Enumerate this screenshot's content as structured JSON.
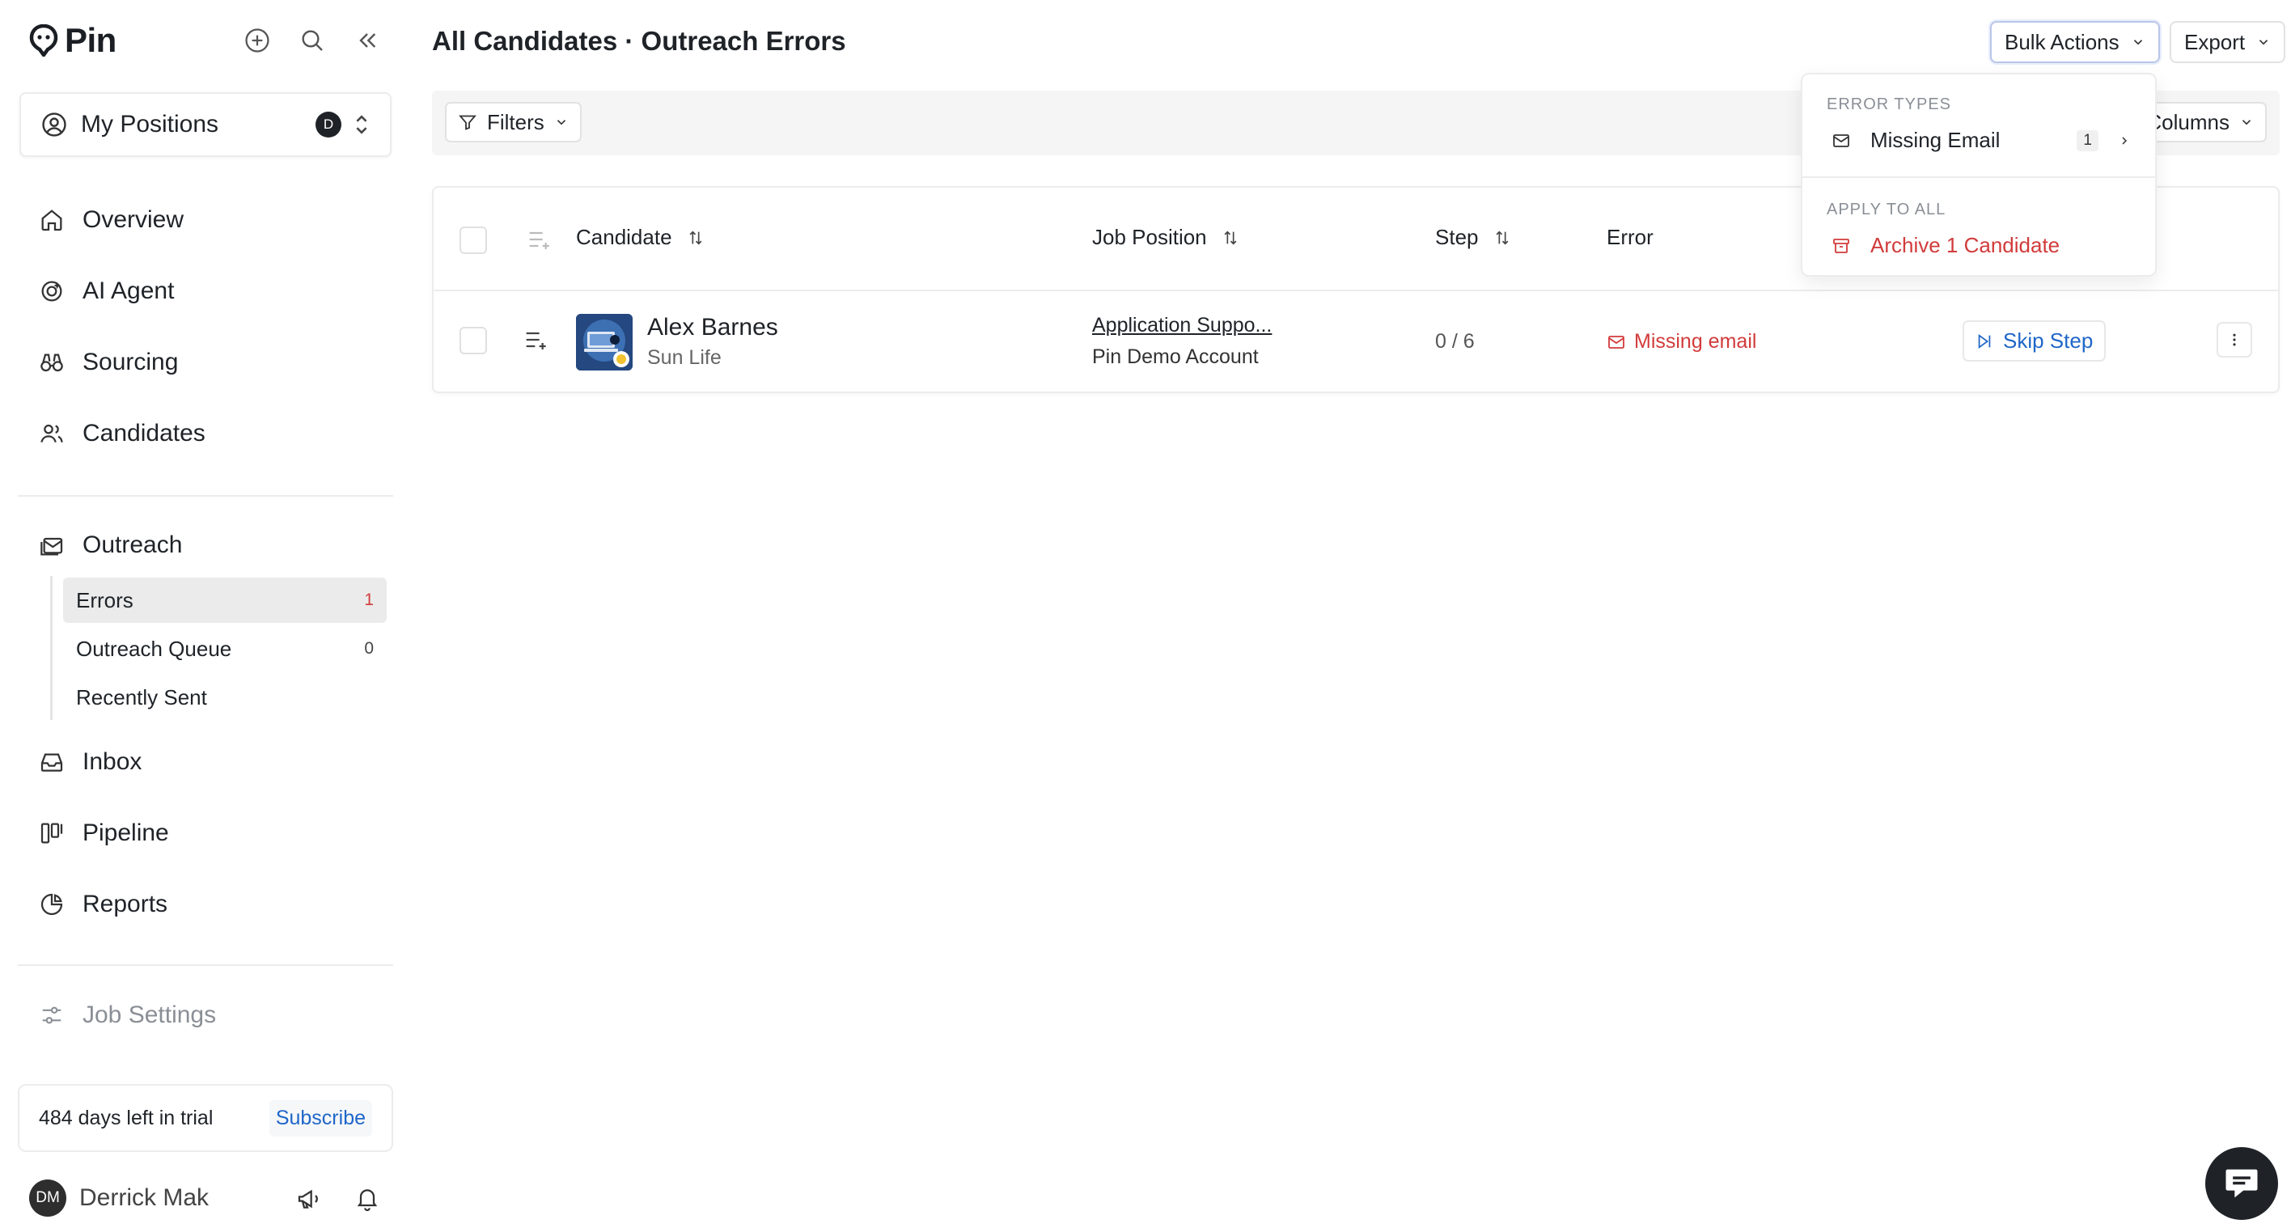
{
  "app": {
    "name": "Pin"
  },
  "sidebar": {
    "positions_label": "My Positions",
    "positions_badge": "D",
    "nav": {
      "overview": "Overview",
      "ai_agent": "AI Agent",
      "sourcing": "Sourcing",
      "candidates": "Candidates",
      "outreach": "Outreach",
      "inbox": "Inbox",
      "pipeline": "Pipeline",
      "reports": "Reports",
      "job_settings": "Job Settings"
    },
    "outreach_sub": [
      {
        "label": "Errors",
        "count": "1"
      },
      {
        "label": "Outreach Queue",
        "count": "0"
      },
      {
        "label": "Recently Sent",
        "count": ""
      }
    ],
    "trial_text": "484 days left in trial",
    "subscribe_label": "Subscribe",
    "user_initials": "DM",
    "user_name": "Derrick Mak"
  },
  "header": {
    "title": "All Candidates · Outreach Errors",
    "bulk_actions_label": "Bulk Actions",
    "export_label": "Export"
  },
  "toolbar": {
    "filters_label": "Filters",
    "columns_label": "Columns"
  },
  "table": {
    "columns": {
      "candidate": "Candidate",
      "job_position": "Job Position",
      "step": "Step",
      "error": "Error"
    },
    "rows": [
      {
        "name": "Alex Barnes",
        "company": "Sun Life",
        "job_title": "Application Suppo...",
        "job_account": "Pin Demo Account",
        "step": "0 / 6",
        "error": "Missing email",
        "action": "Skip Step"
      }
    ]
  },
  "dropdown": {
    "section1": "ERROR TYPES",
    "missing_email_label": "Missing Email",
    "missing_email_count": "1",
    "section2": "APPLY TO ALL",
    "archive_label": "Archive 1 Candidate"
  },
  "colors": {
    "accent_blue": "#1f66c9",
    "error_red": "#d23b3b",
    "text": "#1f2328"
  }
}
